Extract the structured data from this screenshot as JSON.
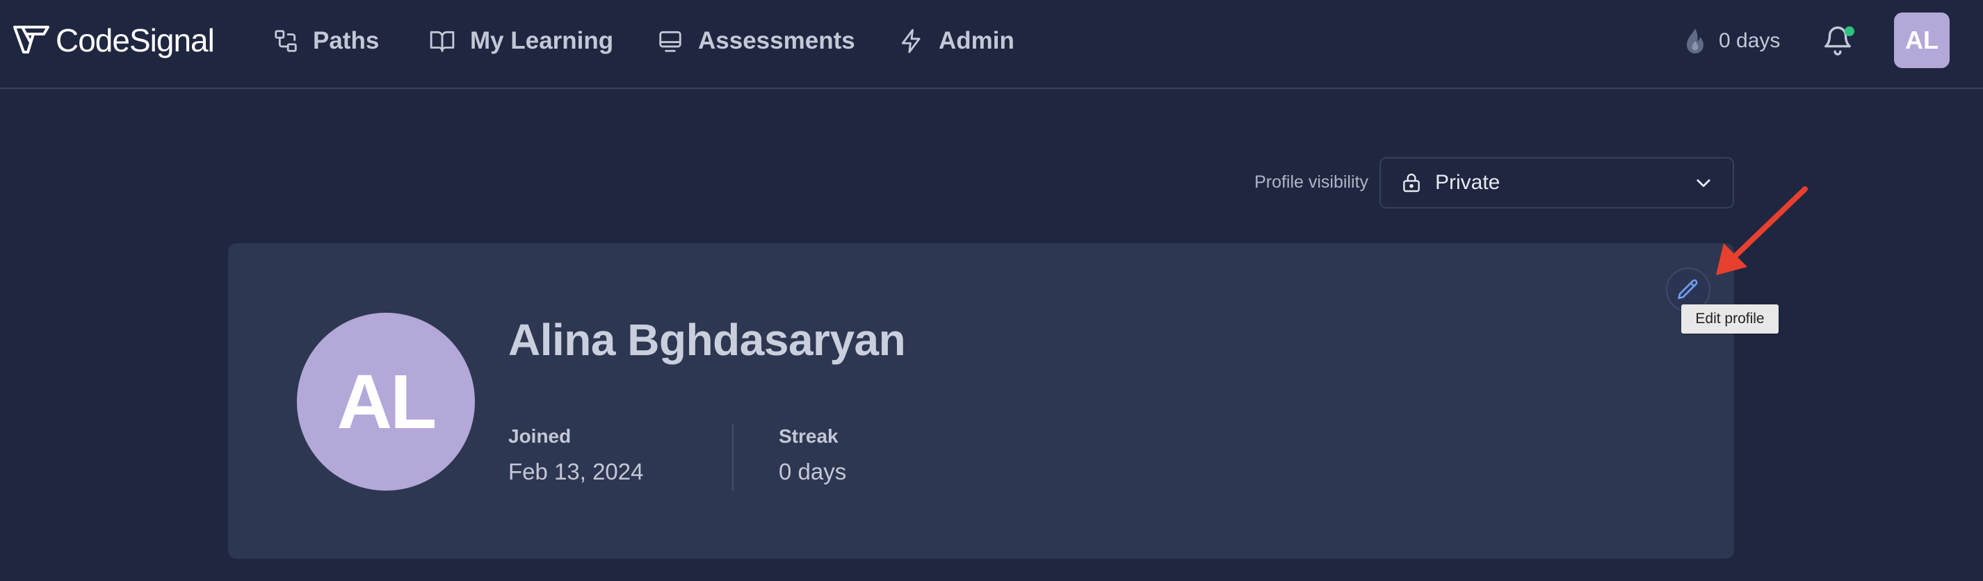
{
  "app": {
    "logo_text": "CodeSignal"
  },
  "nav": {
    "items": [
      {
        "label": "Paths",
        "icon": "paths-icon"
      },
      {
        "label": "My Learning",
        "icon": "book-icon"
      },
      {
        "label": "Assessments",
        "icon": "monitor-icon"
      },
      {
        "label": "Admin",
        "icon": "bolt-icon"
      }
    ],
    "streak": "0 days",
    "avatar_initials": "AL"
  },
  "profile": {
    "visibility_label": "Profile visibility",
    "visibility_value": "Private",
    "avatar_initials": "AL",
    "name": "Alina Bghdasaryan",
    "joined_label": "Joined",
    "joined_value": "Feb 13, 2024",
    "streak_label": "Streak",
    "streak_value": "0 days",
    "edit_tooltip": "Edit profile"
  },
  "colors": {
    "background": "#1f2640",
    "card": "#2e3751",
    "avatar": "#b3a8d8",
    "notification_dot": "#2ec27e",
    "annotation_arrow": "#e8402f"
  }
}
